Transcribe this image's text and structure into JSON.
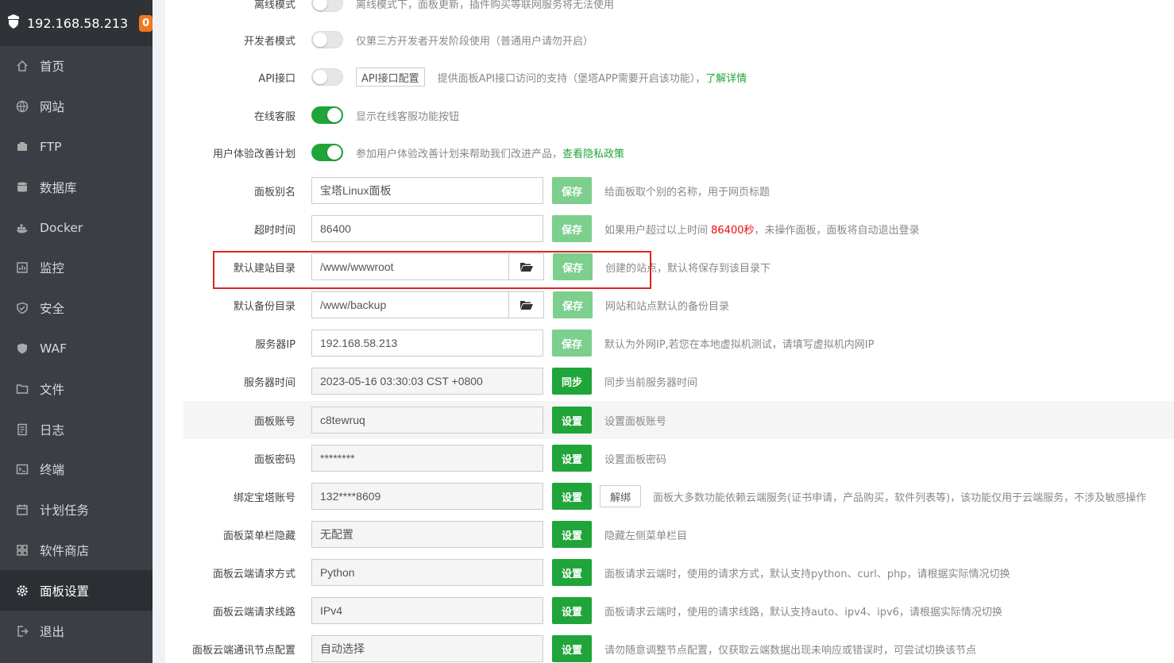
{
  "sidebar": {
    "server_ip": "192.168.58.213",
    "badge_count": "0",
    "items": [
      {
        "label": "首页",
        "icon": "home-icon"
      },
      {
        "label": "网站",
        "icon": "globe-icon"
      },
      {
        "label": "FTP",
        "icon": "ftp-icon"
      },
      {
        "label": "数据库",
        "icon": "database-icon"
      },
      {
        "label": "Docker",
        "icon": "docker-icon"
      },
      {
        "label": "监控",
        "icon": "monitor-icon"
      },
      {
        "label": "安全",
        "icon": "shield-icon"
      },
      {
        "label": "WAF",
        "icon": "waf-shield-icon"
      },
      {
        "label": "文件",
        "icon": "folder-icon"
      },
      {
        "label": "日志",
        "icon": "log-icon"
      },
      {
        "label": "终端",
        "icon": "terminal-icon"
      },
      {
        "label": "计划任务",
        "icon": "calendar-icon"
      },
      {
        "label": "软件商店",
        "icon": "apps-icon"
      },
      {
        "label": "面板设置",
        "icon": "gear-icon"
      },
      {
        "label": "退出",
        "icon": "logout-icon"
      }
    ],
    "active_index": 13
  },
  "settings": {
    "offline": {
      "label": "离线模式",
      "tip": "离线模式下，面板更新，插件购买等联网服务将无法使用",
      "enabled": false
    },
    "dev_mode": {
      "label": "开发者模式",
      "tip": "仅第三方开发者开发阶段使用（普通用户请勿开启）",
      "enabled": false
    },
    "api": {
      "label": "API接口",
      "button": "API接口配置",
      "tip": "提供面板API接口访问的支持（堡塔APP需要开启该功能），",
      "link": "了解详情",
      "enabled": false
    },
    "online_service": {
      "label": "在线客服",
      "tip": "显示在线客服功能按钮",
      "enabled": true
    },
    "ux_plan": {
      "label": "用户体验改善计划",
      "tip": "参加用户体验改善计划来帮助我们改进产品，",
      "link": "查看隐私政策",
      "enabled": true
    },
    "panel_alias": {
      "label": "面板别名",
      "value": "宝塔Linux面板",
      "button": "保存",
      "tip": "给面板取个别的名称，用于网页标题"
    },
    "timeout": {
      "label": "超时时间",
      "value": "86400",
      "button": "保存",
      "tip_before": "如果用户超过以上时间 ",
      "tip_highlight": "86400秒",
      "tip_after": "，未操作面板，面板将自动退出登录"
    },
    "site_dir": {
      "label": "默认建站目录",
      "value": "/www/wwwroot",
      "button": "保存",
      "tip": "创建的站点，默认将保存到该目录下"
    },
    "backup_dir": {
      "label": "默认备份目录",
      "value": "/www/backup",
      "button": "保存",
      "tip": "网站和站点默认的备份目录"
    },
    "server_ip": {
      "label": "服务器IP",
      "value": "192.168.58.213",
      "button": "保存",
      "tip": "默认为外网IP,若您在本地虚拟机测试，请填写虚拟机内网IP"
    },
    "server_time": {
      "label": "服务器时间",
      "value": "2023-05-16 03:30:03 CST +0800",
      "button": "同步",
      "tip": "同步当前服务器时间"
    },
    "panel_user": {
      "label": "面板账号",
      "value": "c8tewruq",
      "button": "设置",
      "tip": "设置面板账号"
    },
    "panel_password": {
      "label": "面板密码",
      "value": "********",
      "button": "设置",
      "tip": "设置面板密码"
    },
    "bt_account": {
      "label": "绑定宝塔账号",
      "value": "132****8609",
      "button": "设置",
      "unbind": "解绑",
      "tip": "面板大多数功能依赖云端服务(证书申请，产品购买，软件列表等)，该功能仅用于云端服务，不涉及敏感操作"
    },
    "menu_hide": {
      "label": "面板菜单栏隐藏",
      "value": "无配置",
      "button": "设置",
      "tip": "隐藏左侧菜单栏目"
    },
    "cloud_method": {
      "label": "面板云端请求方式",
      "value": "Python",
      "button": "设置",
      "tip": "面板请求云端时，使用的请求方式，默认支持python、curl、php，请根据实际情况切换"
    },
    "cloud_line": {
      "label": "面板云端请求线路",
      "value": "IPv4",
      "button": "设置",
      "tip": "面板请求云端时，使用的请求线路，默认支持auto、ipv4、ipv6，请根据实际情况切换"
    },
    "cloud_node": {
      "label": "面板云端通讯节点配置",
      "value": "自动选择",
      "button": "设置",
      "tip": "请勿随意调整节点配置，仅获取云端数据出现未响应或错误时，可尝试切换该节点"
    }
  },
  "colors": {
    "accent": "#20a53a",
    "accent_light": "#7ccf8c",
    "sidebar_bg": "#3b3f45",
    "highlight": "#e02222",
    "badge": "#f0781e"
  }
}
